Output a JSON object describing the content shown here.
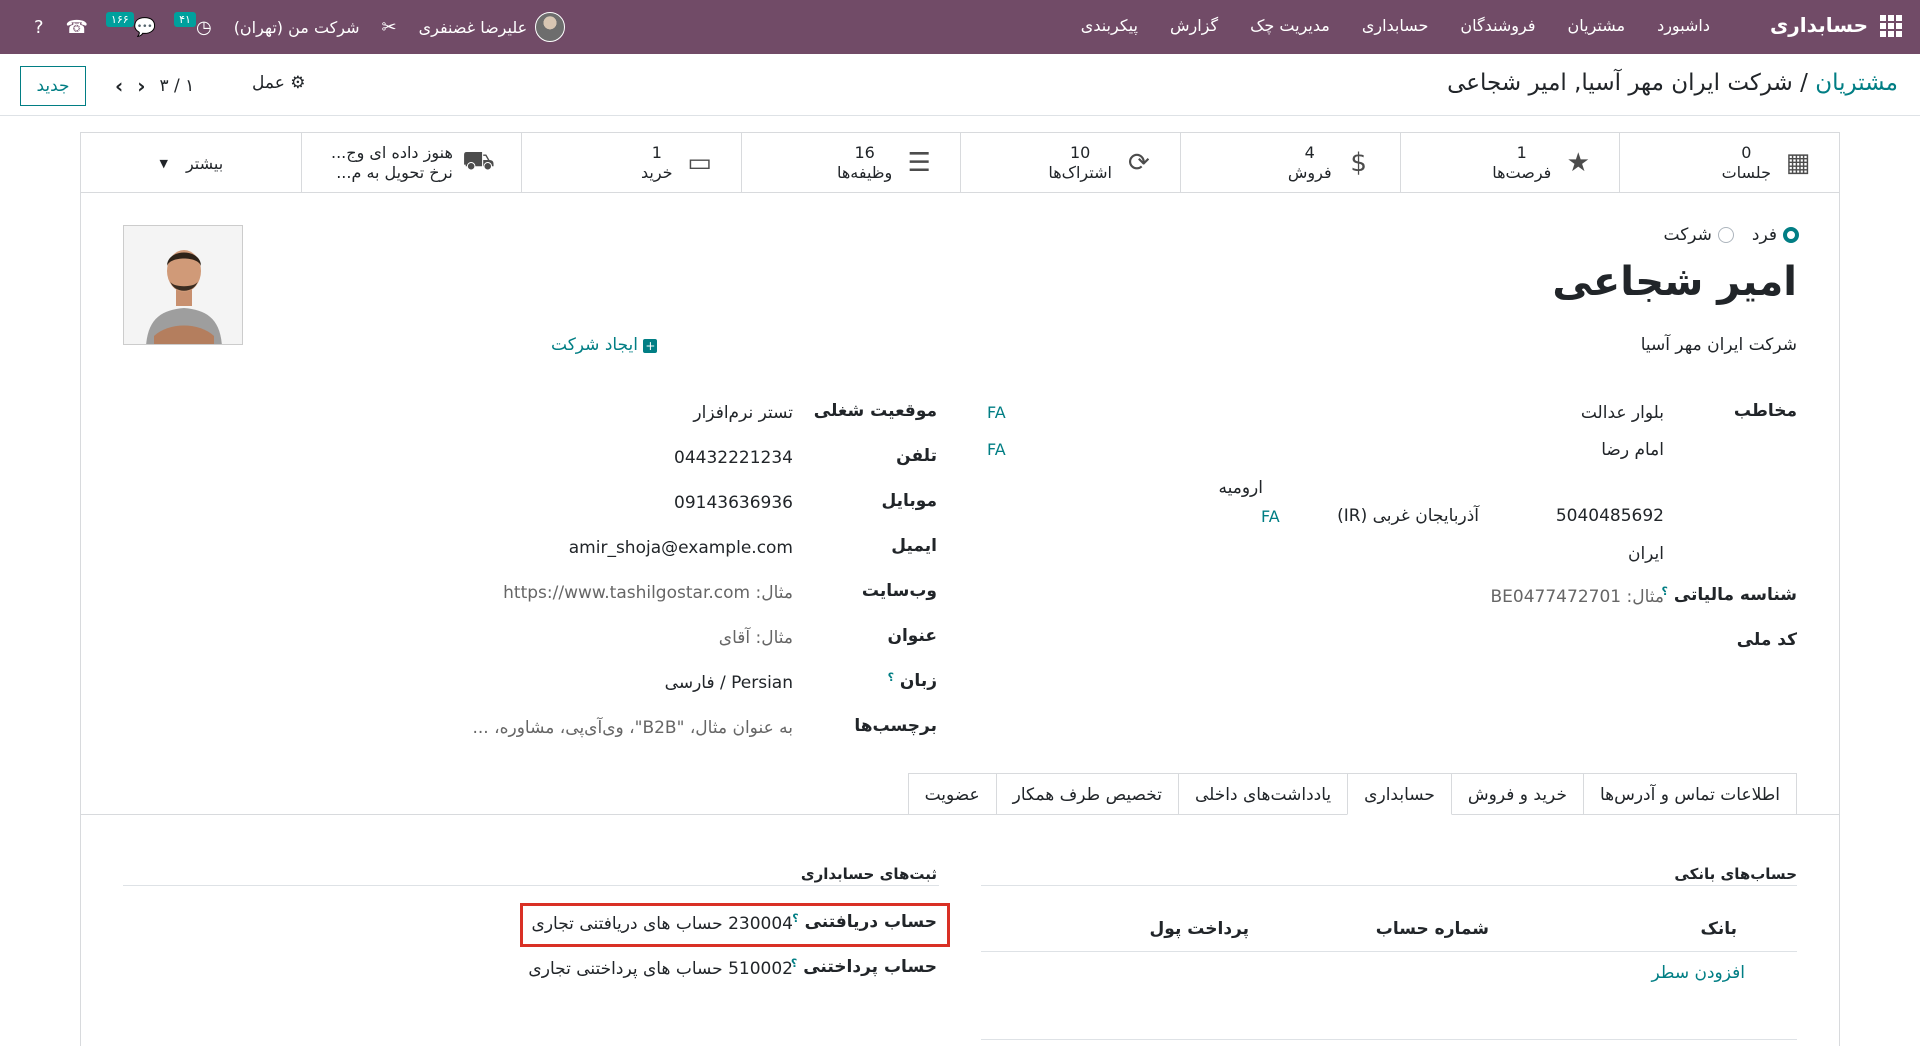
{
  "navbar": {
    "app_name": "حسابداری",
    "menu": [
      "داشبورد",
      "مشتریان",
      "فروشندگان",
      "حسابداری",
      "مدیریت چک",
      "گزارش",
      "پیکربندی"
    ],
    "user_name": "علیرضا غضنفری",
    "company": "شرکت من (تهران)",
    "activity_count": "۴۱",
    "message_count": "۱۶۶"
  },
  "control": {
    "breadcrumb_parent": "مشتریان",
    "breadcrumb_sep": "/",
    "breadcrumb_current": "شرکت ایران مهر آسیا, امیر شجاعی",
    "new_button": "جدید",
    "pager": "۳ / ۱",
    "action": "عمل"
  },
  "smart_buttons": [
    {
      "value": "0",
      "label": "جلسات",
      "icon": "calendar-icon"
    },
    {
      "value": "1",
      "label": "فرصت‌ها",
      "icon": "star-icon"
    },
    {
      "value": "4",
      "label": "فروش",
      "icon": "dollar-icon"
    },
    {
      "value": "10",
      "label": "اشتراک‌ها",
      "icon": "refresh-icon"
    },
    {
      "value": "16",
      "label": "وظیفه‌ها",
      "icon": "tasks-icon"
    },
    {
      "value": "1",
      "label": "خرید",
      "icon": "credit-card-icon"
    },
    {
      "value": "هنوز داده ای وج...",
      "label": "نرخ تحویل به م...",
      "icon": "truck-icon"
    },
    {
      "value": "",
      "label": "بیشتر",
      "icon": "caret-down-icon"
    }
  ],
  "partner": {
    "type_individual": "فرد",
    "type_company": "شرکت",
    "name": "امیر شجاعی",
    "company": "شرکت ایران مهر آسیا",
    "create_company": "ایجاد شرکت"
  },
  "address": {
    "label": "مخاطب",
    "street": "بلوار عدالت",
    "street2": "امام رضا",
    "city": "ارومیه",
    "zip": "5040485692",
    "state": "آذربایجان غربی (IR)",
    "country": "ایران",
    "fa": "FA"
  },
  "tax": {
    "vat_label": "شناسه مالیاتی",
    "vat_placeholder": "مثال: BE0477472701",
    "national_code_label": "کد ملی"
  },
  "right_fields": [
    {
      "label": "موقعیت شغلی",
      "value": "تستر نرم‌افزار",
      "placeholder": false
    },
    {
      "label": "تلفن",
      "value": "04432221234",
      "placeholder": false
    },
    {
      "label": "موبایل",
      "value": "09143636936",
      "placeholder": false
    },
    {
      "label": "ایمیل",
      "value": "amir_shoja@example.com",
      "placeholder": false
    },
    {
      "label": "وب‌سایت",
      "value": "مثال: https://www.tashilgostar.com",
      "placeholder": true
    },
    {
      "label": "عنوان",
      "value": "مثال: آقای",
      "placeholder": true
    },
    {
      "label": "زبان",
      "value": "Persian / فارسی",
      "placeholder": false
    },
    {
      "label": "برچسب‌ها",
      "value": "به عنوان مثال، \"B2B\"، وی‌آی‌پی، مشاوره، ...",
      "placeholder": true
    }
  ],
  "tabs": [
    "اطلاعات تماس و آدرس‌ها",
    "خرید و فروش",
    "حسابداری",
    "یادداشت‌های داخلی",
    "تخصیص طرف همکار",
    "عضویت"
  ],
  "active_tab": 2,
  "bank": {
    "title": "حساب‌های بانکی",
    "col_bank": "بانک",
    "col_account": "شماره حساب",
    "col_payment": "پرداخت پول",
    "add_line": "افزودن سطر"
  },
  "accounting": {
    "title": "ثبت‌های حسابداری",
    "receivable_label": "حساب دریافتنی",
    "receivable_value": "230004 حساب های دریافتنی تجاری",
    "payable_label": "حساب پرداختنی",
    "payable_value": "510002 حساب های پرداختنی تجاری"
  },
  "colors": {
    "brand": "#714B67",
    "accent": "#017E84",
    "highlight": "#d93025"
  }
}
